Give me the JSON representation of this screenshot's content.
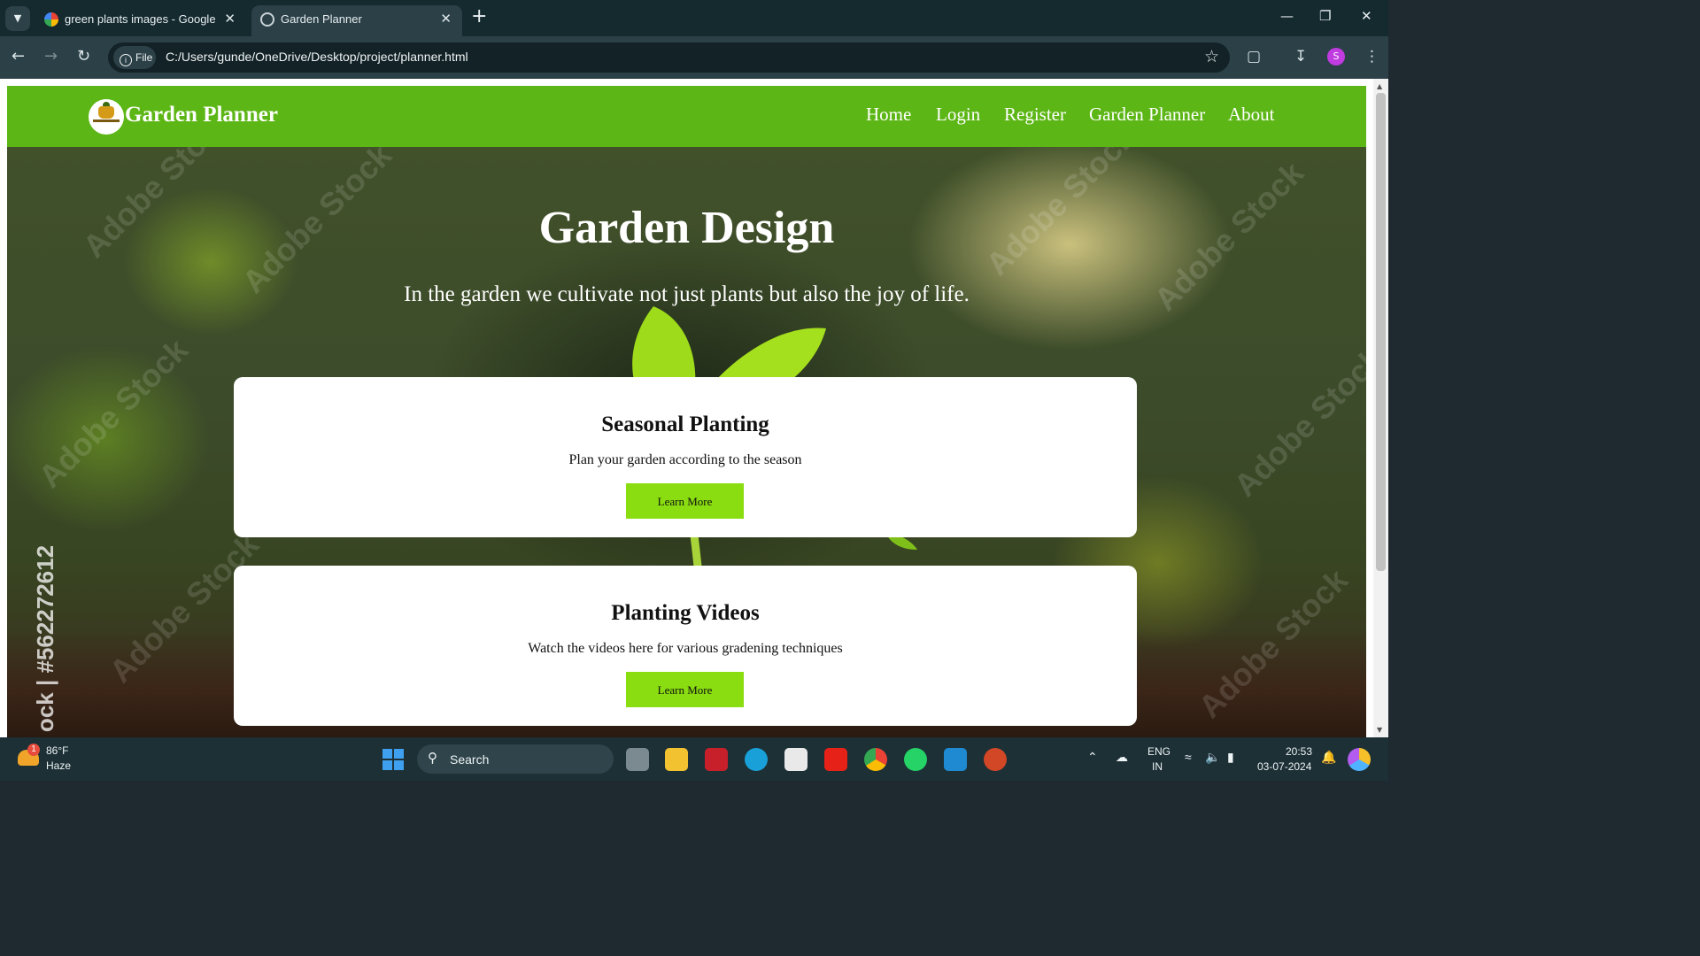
{
  "browser": {
    "tabs": [
      {
        "title": "green plants images - Google S",
        "active": false
      },
      {
        "title": "Garden Planner",
        "active": true
      }
    ],
    "url_chip": "File",
    "url": "C:/Users/gunde/OneDrive/Desktop/project/planner.html",
    "profile_initial": "S"
  },
  "site": {
    "brand": "Garden Planner",
    "nav": [
      "Home",
      "Login",
      "Register",
      "Garden Planner",
      "About"
    ],
    "hero": {
      "title": "Garden Design",
      "tagline": "In the garden we cultivate not just plants but also the joy of life."
    },
    "cards": [
      {
        "title": "Seasonal Planting",
        "text": "Plan your garden according to the season",
        "button": "Learn More"
      },
      {
        "title": "Planting Videos",
        "text": "Watch the videos here for various gradening techniques",
        "button": "Learn More"
      }
    ],
    "watermark": "Adobe Stock",
    "stock_id": "ock | #562272612"
  },
  "colors": {
    "navbar": "#5cb615",
    "button": "#89dd10"
  },
  "taskbar": {
    "weather_temp": "86°F",
    "weather_desc": "Haze",
    "weather_badge": "1",
    "search_label": "Search",
    "lang": "ENG",
    "region": "IN",
    "time": "20:53",
    "date": "03-07-2024"
  }
}
